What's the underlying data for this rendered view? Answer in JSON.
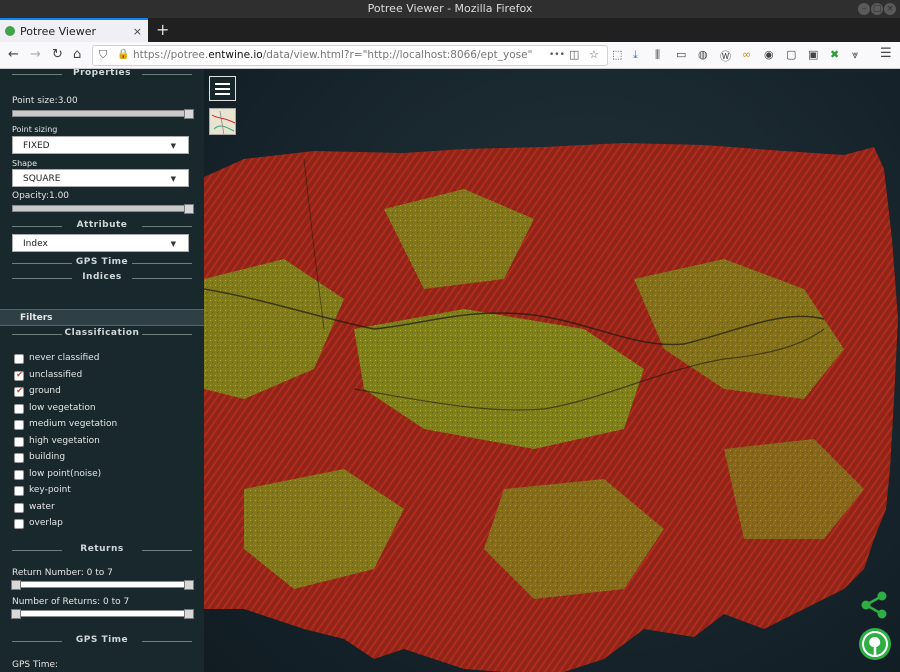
{
  "window": {
    "title": "Potree Viewer - Mozilla Firefox"
  },
  "tab": {
    "label": "Potree Viewer",
    "close": "×",
    "new_tab": "+"
  },
  "navbar": {
    "back": "←",
    "forward": "→",
    "reload": "↻",
    "home": "⌂",
    "url_prefix": "https://potree.",
    "url_domain": "entwine.io",
    "url_suffix": "/data/view.html?r=\"http://localhost:8066/ept_yose\"",
    "more": "•••",
    "menu": "☰"
  },
  "sidebar": {
    "properties": {
      "header": "Properties",
      "point_size_label": "Point size:3.00",
      "point_size_value": 3.0,
      "point_sizing_label": "Point sizing",
      "point_sizing_value": "FIXED",
      "shape_label": "Shape",
      "shape_value": "SQUARE",
      "opacity_label": "Opacity:1.00",
      "opacity_value": 1.0
    },
    "attribute": {
      "header": "Attribute",
      "value": "Index",
      "gps_time_header": "GPS Time",
      "indices_header": "Indices"
    },
    "filters": {
      "label": "Filters",
      "classification_header": "Classification",
      "classes": [
        {
          "label": "never classified",
          "checked": false
        },
        {
          "label": "unclassified",
          "checked": true
        },
        {
          "label": "ground",
          "checked": true
        },
        {
          "label": "low vegetation",
          "checked": false
        },
        {
          "label": "medium vegetation",
          "checked": false
        },
        {
          "label": "high vegetation",
          "checked": false
        },
        {
          "label": "building",
          "checked": false
        },
        {
          "label": "low point(noise)",
          "checked": false
        },
        {
          "label": "key-point",
          "checked": false
        },
        {
          "label": "water",
          "checked": false
        },
        {
          "label": "overlap",
          "checked": false
        }
      ],
      "returns_header": "Returns",
      "return_number_label": "Return Number: 0 to 7",
      "return_number_range": [
        0,
        7
      ],
      "number_of_returns_label": "Number of Returns: 0 to 7",
      "number_of_returns_range": [
        0,
        7
      ],
      "gps_time_header": "GPS Time",
      "gps_time_label": "GPS Time:"
    }
  },
  "colors": {
    "sidebar_bg": "#19282c",
    "viewer_bg": "#15222a",
    "point_red": "#a3251a",
    "point_yellow": "#9aa81e",
    "logo_green": "#3ea34a"
  },
  "icons": {
    "menu": "hamburger-icon",
    "map": "map-thumbnail-icon",
    "share": "share-icon",
    "logo": "potree-logo-icon"
  }
}
